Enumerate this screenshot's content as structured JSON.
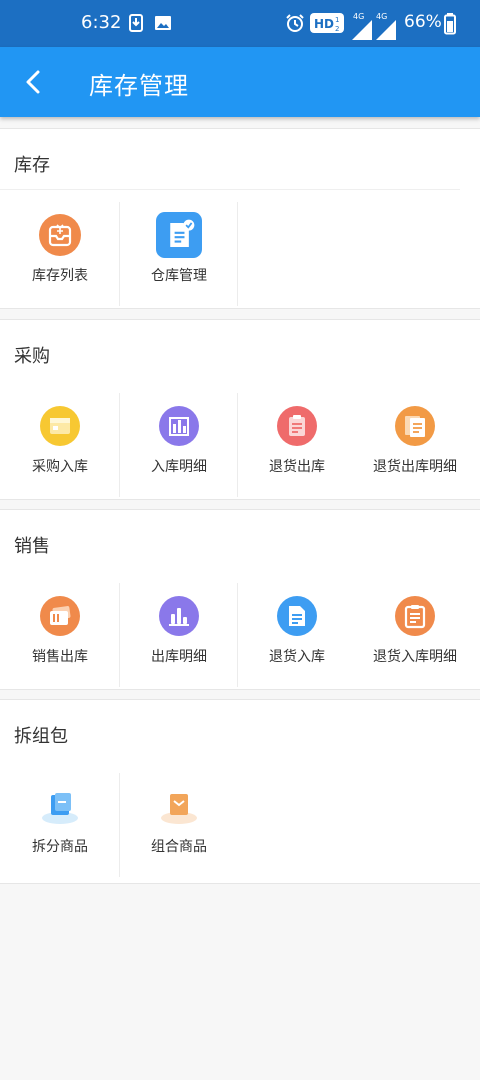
{
  "status_bar": {
    "time": "6:32",
    "network_1": "4G",
    "network_2": "4G",
    "battery": "66%",
    "icons": [
      "download-icon",
      "image-icon",
      "alarm-icon",
      "hd-icon",
      "signal-icon",
      "battery-icon"
    ]
  },
  "header": {
    "title": "库存管理",
    "back_icon": "chevron-left-icon"
  },
  "colors": {
    "status_bar_bg": "#1c6fc2",
    "app_bar_bg": "#2196f3",
    "page_bg": "#f7f7f7"
  },
  "sections": [
    {
      "title": "库存",
      "items": [
        {
          "label": "库存列表",
          "icon": "inventory-list-icon",
          "color": "#f08a4b"
        },
        {
          "label": "仓库管理",
          "icon": "warehouse-manage-icon",
          "color": "#3d9df2"
        }
      ]
    },
    {
      "title": "采购",
      "items": [
        {
          "label": "采购入库",
          "icon": "purchase-in-icon",
          "color": "#f7c832"
        },
        {
          "label": "入库明细",
          "icon": "in-detail-icon",
          "color": "#8a78ea"
        },
        {
          "label": "退货出库",
          "icon": "return-out-icon",
          "color": "#ef6b6b"
        },
        {
          "label": "退货出库明细",
          "icon": "return-out-detail-icon",
          "color": "#f29a45"
        }
      ]
    },
    {
      "title": "销售",
      "items": [
        {
          "label": "销售出库",
          "icon": "sales-out-icon",
          "color": "#f08a4b"
        },
        {
          "label": "出库明细",
          "icon": "out-detail-icon",
          "color": "#8a78ea"
        },
        {
          "label": "退货入库",
          "icon": "return-in-icon",
          "color": "#3d9df2"
        },
        {
          "label": "退货入库明细",
          "icon": "return-in-detail-icon",
          "color": "#f08a4b"
        }
      ]
    },
    {
      "title": "拆组包",
      "items": [
        {
          "label": "拆分商品",
          "icon": "split-goods-icon",
          "color": "#3d9df2"
        },
        {
          "label": "组合商品",
          "icon": "combine-goods-icon",
          "color": "#f2a55a"
        }
      ]
    }
  ]
}
